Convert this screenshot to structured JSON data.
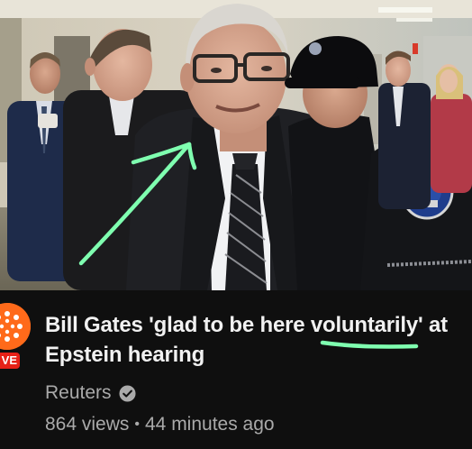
{
  "video": {
    "title": "Bill Gates 'glad to be here voluntarily' at Epstein hearing",
    "channel": "Reuters",
    "views": "864 views",
    "age": "44 minutes ago",
    "separator": "•",
    "live_badge": "VE",
    "verified_icon": "verified-check-icon"
  },
  "colors": {
    "background": "#0f0f0f",
    "title": "#f1f1f1",
    "secondary_text": "#aaaaaa",
    "live_red": "#e62117",
    "annotation_green": "#7fffb0"
  }
}
